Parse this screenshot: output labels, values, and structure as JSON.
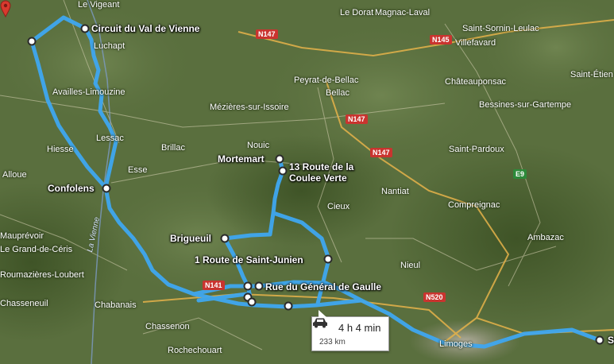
{
  "map": {
    "places": [
      "Le Vigeant",
      "Luchapt",
      "Le Dorat",
      "Magnac-Laval",
      "Saint-Sornin-Leulac",
      "Villefavard",
      "Availles-Limouzine",
      "Peyrat-de-Bellac",
      "Bellac",
      "Mézières-sur-Issoire",
      "Châteauponsac",
      "Saint-Étien",
      "Bessines-sur-Gartempe",
      "Lessac",
      "Brillac",
      "Nouic",
      "Saint-Pardoux",
      "Hiesse",
      "Esse",
      "Alloue",
      "Nantiat",
      "Cieux",
      "Compreignac",
      "Ambazac",
      "Mauprévoir",
      "Le Grand-de-Céris",
      "Roumazières-Loubert",
      "Nieul",
      "Chabanais",
      "Chasseneuil",
      "Chassenon",
      "Rochechouart",
      "Limoges"
    ],
    "river": "La Vienne",
    "roads": [
      "N147",
      "N145",
      "N147",
      "N147",
      "N141",
      "N520",
      "E9"
    ],
    "waypoints": [
      "Circuit du Val de Vienne",
      "Confolens",
      "Mortemart",
      "13 Route de la Coulee Verte",
      "Brigueuil",
      "1 Route de Saint-Junien",
      "Rue du Général de Gaulle"
    ],
    "destination_label": "S"
  },
  "route_info": {
    "duration": "4 h 4 min",
    "distance": "233 km"
  },
  "colors": {
    "route": "#3fa7f0",
    "road_shield": "#c9342f",
    "pin": "#d83a2e"
  }
}
